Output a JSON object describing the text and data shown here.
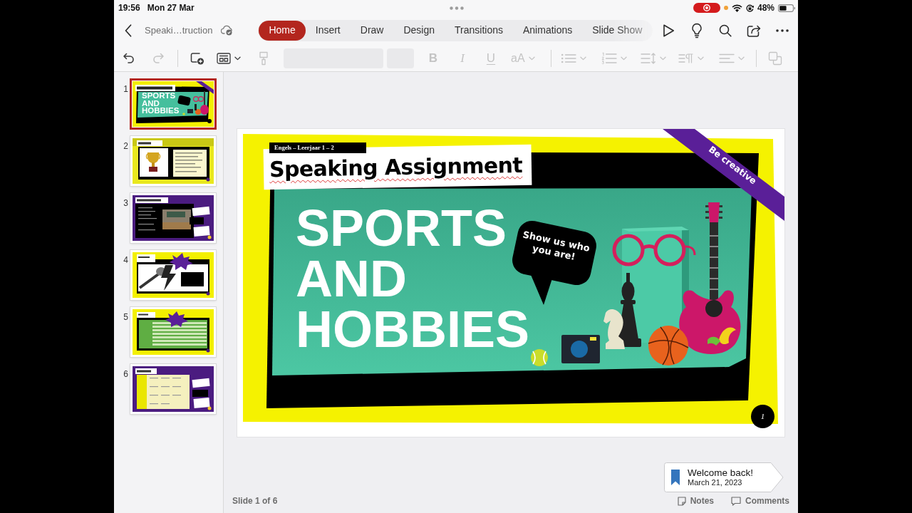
{
  "status_bar": {
    "time": "19:56",
    "date": "Mon 27 Mar",
    "battery": "48%"
  },
  "title_bar": {
    "document_title": "Speaki…truction"
  },
  "ribbon_tabs": [
    {
      "label": "Home",
      "selected": true
    },
    {
      "label": "Insert",
      "selected": false
    },
    {
      "label": "Draw",
      "selected": false
    },
    {
      "label": "Design",
      "selected": false
    },
    {
      "label": "Transitions",
      "selected": false
    },
    {
      "label": "Animations",
      "selected": false
    },
    {
      "label": "Slide Show",
      "selected": false
    }
  ],
  "toolbar": {
    "undo_button": {
      "disabled": false
    },
    "redo_button": {
      "disabled": true
    },
    "new_slide_button": {
      "disabled": false
    },
    "layout_button": {
      "disabled": false
    },
    "format_painter_button": {
      "disabled": true
    },
    "bold_button": {
      "label": "B",
      "disabled": true
    },
    "italic_button": {
      "label": "I",
      "disabled": true
    },
    "underline_button": {
      "label": "U",
      "disabled": true
    },
    "font_size_menu": {
      "label": "aA",
      "disabled": true
    },
    "bullets_button": {
      "disabled": true
    },
    "numbering_button": {
      "disabled": true
    },
    "line_spacing_button": {
      "disabled": true
    },
    "text_direction_button": {
      "disabled": true
    },
    "align_button": {
      "disabled": true
    },
    "arrange_button": {
      "disabled": true
    }
  },
  "thumbnails": [
    {
      "number": "1",
      "selected": true,
      "heading": "SPORTS AND HOBBIES"
    },
    {
      "number": "2",
      "selected": false
    },
    {
      "number": "3",
      "selected": false
    },
    {
      "number": "4",
      "selected": false
    },
    {
      "number": "5",
      "selected": false
    },
    {
      "number": "6",
      "selected": false
    }
  ],
  "slide": {
    "course_label": "Engels – Leerjaar 1 – 2",
    "title": "Speaking Assignment",
    "title_spelling_flagged": true,
    "heading": [
      "SPORTS",
      "AND",
      "HOBBIES"
    ],
    "ribbon": "Be creative",
    "speech_bubble": "Show us who you are!",
    "slide_number": "1"
  },
  "footer": {
    "slide_counter": "Slide 1 of 6",
    "notes_button": "Notes",
    "comments_button": "Comments"
  },
  "toast": {
    "title": "Welcome back!",
    "date": "March 21, 2023"
  }
}
